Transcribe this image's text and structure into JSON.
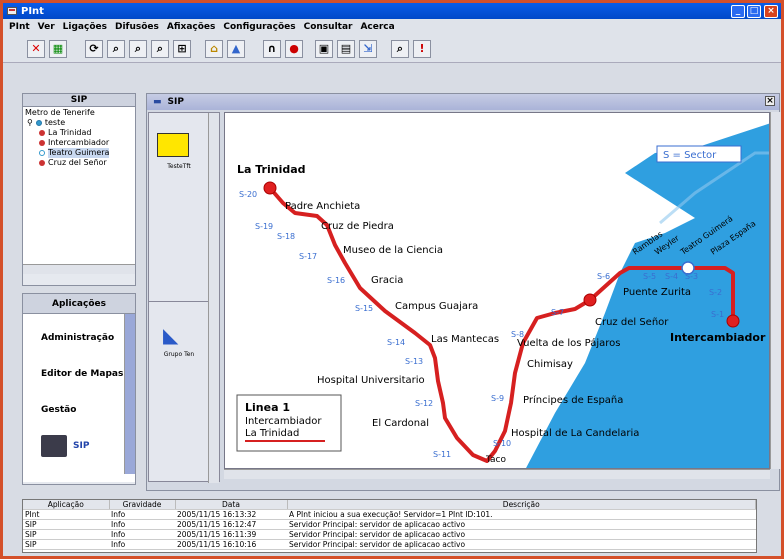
{
  "window": {
    "title": "PInt"
  },
  "menu": [
    "PInt",
    "Ver",
    "Ligações",
    "Difusões",
    "Afixações",
    "Configurações",
    "Consultar",
    "Acerca"
  ],
  "tree": {
    "header": "SIP",
    "root": "Metro de Tenerife",
    "node": "teste",
    "children": [
      "La Trinidad",
      "Intercambiador",
      "Teatro Guimera",
      "Cruz del Señor"
    ]
  },
  "apps": {
    "header": "Aplicações",
    "items": [
      "Administração",
      "Editor de Mapas",
      "Gestão",
      "SIP"
    ]
  },
  "doc": {
    "tab": "SIP",
    "thumbs": [
      "TesteTft",
      "Grupo Ten"
    ]
  },
  "map": {
    "legend_sector": "S = Sector",
    "line_title": "Linea 1",
    "line_from": "Intercambiador",
    "line_to": "La Trinidad",
    "colors": {
      "line": "#d62020",
      "sea": "#2f9fe0",
      "sector": "#3a6ed0"
    },
    "stops": [
      {
        "name": "La Trinidad",
        "sector": "S-20",
        "terminal": true
      },
      {
        "name": "Padre Anchieta",
        "sector": "S-19"
      },
      {
        "name": "Cruz de Piedra",
        "sector": "S-18"
      },
      {
        "name": "Museo de la Ciencia",
        "sector": "S-17"
      },
      {
        "name": "Gracia",
        "sector": "S-16"
      },
      {
        "name": "Campus Guajara",
        "sector": "S-15"
      },
      {
        "name": "Las Mantecas",
        "sector": "S-14"
      },
      {
        "name": "Hospital Universitario",
        "sector": "S-13"
      },
      {
        "name": "El Cardonal",
        "sector": "S-12"
      },
      {
        "name": "Taco",
        "sector": "S-11"
      },
      {
        "name": "Hospital de La Candelaria",
        "sector": "S-10"
      },
      {
        "name": "Príncipes de España",
        "sector": "S-9"
      },
      {
        "name": "Chimisay",
        "sector": ""
      },
      {
        "name": "Vuelta de los Pájaros",
        "sector": "S-8"
      },
      {
        "name": "Cruz del Señor",
        "sector": "S-7"
      },
      {
        "name": "Puente Zurita",
        "sector": "S-6"
      },
      {
        "name": "Ramblas",
        "sector": "S-5"
      },
      {
        "name": "Weyler",
        "sector": "S-4"
      },
      {
        "name": "Teatro Guimerá",
        "sector": "S-3"
      },
      {
        "name": "Plaza España",
        "sector": "S-2"
      },
      {
        "name": "Intercambiador",
        "sector": "S-1",
        "terminal": true
      }
    ]
  },
  "log": {
    "columns": [
      "Aplicação",
      "Gravidade",
      "Data",
      "Descrição"
    ],
    "rows": [
      [
        "PInt",
        "Info",
        "2005/11/15 16:13:32",
        "A PInt iniciou a sua execução! Servidor=1 PInt ID:101."
      ],
      [
        "SIP",
        "Info",
        "2005/11/15 16:12:47",
        "Servidor Principal: servidor de aplicacao activo"
      ],
      [
        "SIP",
        "Info",
        "2005/11/15 16:11:39",
        "Servidor Principal: servidor de aplicacao activo"
      ],
      [
        "SIP",
        "Info",
        "2005/11/15 16:10:16",
        "Servidor Principal: servidor de aplicacao activo"
      ]
    ]
  }
}
